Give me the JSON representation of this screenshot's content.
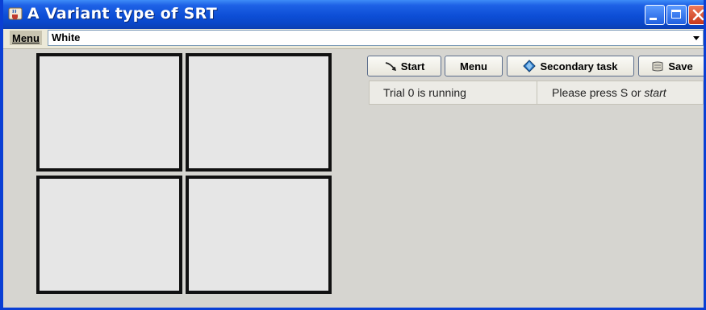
{
  "window": {
    "title": "A Variant type of SRT"
  },
  "menubar": {
    "menu_label": "Menu",
    "combo_value": "White"
  },
  "toolbar": {
    "start_label": "Start",
    "menu_label": "Menu",
    "secondary_task_label": "Secondary task",
    "save_label": "Save"
  },
  "status": {
    "trial_text": "Trial 0 is running",
    "instruction_prefix": "Please press S or ",
    "instruction_emphasis": "start"
  },
  "icons": {
    "app": "java-cup-icon",
    "start": "arrow-icon",
    "secondary_task": "diamond-icon",
    "save": "floppy-icon"
  },
  "colors": {
    "titlebar": "#0d4ed6",
    "window_bg": "#d6d5d0",
    "box_border": "#111111",
    "box_fill": "#e6e6e6"
  }
}
